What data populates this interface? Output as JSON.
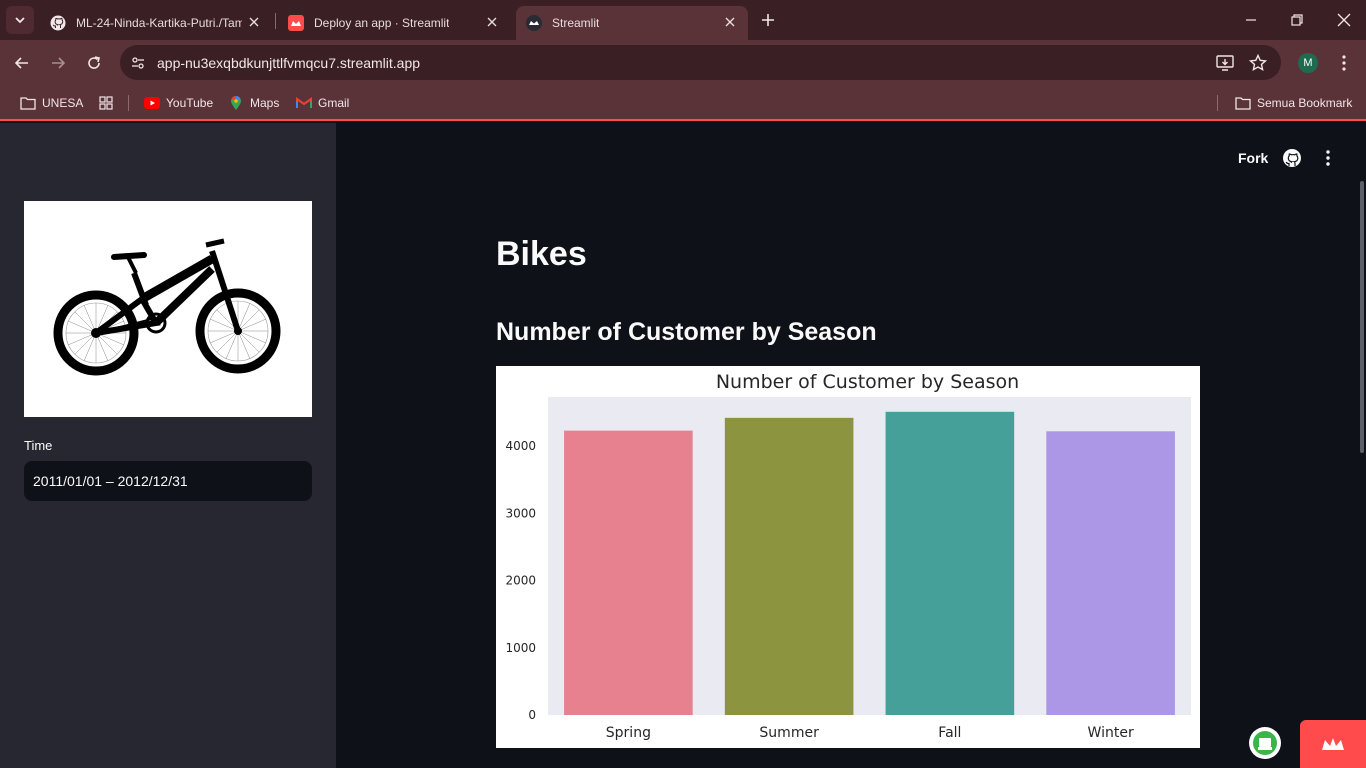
{
  "browser": {
    "tabs": [
      {
        "title": "ML-24-Ninda-Kartika-Putri./Tam",
        "active": false
      },
      {
        "title": "Deploy an app · Streamlit",
        "active": false
      },
      {
        "title": "Streamlit",
        "active": true
      }
    ],
    "url": "app-nu3exqbdkunjttlfvmqcu7.streamlit.app",
    "profile_initial": "M",
    "bookmarks": [
      "UNESA",
      "YouTube",
      "Maps",
      "Gmail"
    ],
    "all_bookmarks": "Semua Bookmark"
  },
  "app": {
    "fork_label": "Fork",
    "title": "Bikes",
    "subtitle": "Number of Customer by Season",
    "sidebar": {
      "time_label": "Time",
      "date_range": "2011/01/01 – 2012/12/31"
    }
  },
  "colors": {
    "accent": "#ff4b4b",
    "sidebar_bg": "#262730",
    "main_bg": "#0e1117"
  },
  "chart_data": {
    "type": "bar",
    "title": "Number of Customer by Season",
    "xlabel": "",
    "ylabel": "",
    "categories": [
      "Spring",
      "Summer",
      "Fall",
      "Winter"
    ],
    "values": [
      4230,
      4420,
      4510,
      4220
    ],
    "colors": [
      "#e7808f",
      "#8c9440",
      "#46a09a",
      "#ab97e6"
    ],
    "yticks": [
      0,
      1000,
      2000,
      3000,
      4000
    ],
    "ylim": [
      0,
      4730
    ],
    "grid": false,
    "legend": "none"
  }
}
